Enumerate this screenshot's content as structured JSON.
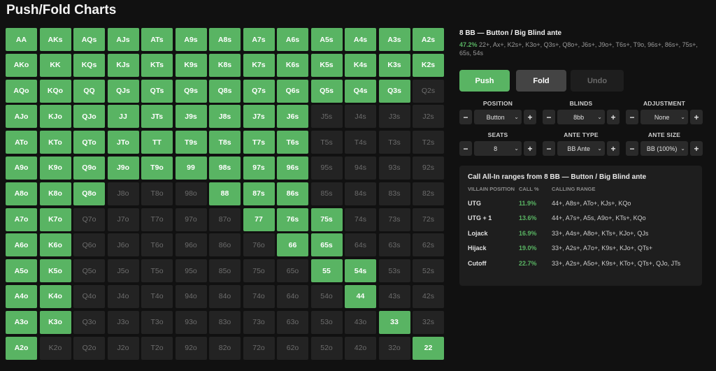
{
  "page": {
    "title": "Push/Fold Charts"
  },
  "colors": {
    "push": "#59b463",
    "fold": "#232323",
    "background": "#111111"
  },
  "grid": {
    "rows": [
      [
        {
          "hand": "AA",
          "action": "push"
        },
        {
          "hand": "AKs",
          "action": "push"
        },
        {
          "hand": "AQs",
          "action": "push"
        },
        {
          "hand": "AJs",
          "action": "push"
        },
        {
          "hand": "ATs",
          "action": "push"
        },
        {
          "hand": "A9s",
          "action": "push"
        },
        {
          "hand": "A8s",
          "action": "push"
        },
        {
          "hand": "A7s",
          "action": "push"
        },
        {
          "hand": "A6s",
          "action": "push"
        },
        {
          "hand": "A5s",
          "action": "push"
        },
        {
          "hand": "A4s",
          "action": "push"
        },
        {
          "hand": "A3s",
          "action": "push"
        },
        {
          "hand": "A2s",
          "action": "push"
        }
      ],
      [
        {
          "hand": "AKo",
          "action": "push"
        },
        {
          "hand": "KK",
          "action": "push"
        },
        {
          "hand": "KQs",
          "action": "push"
        },
        {
          "hand": "KJs",
          "action": "push"
        },
        {
          "hand": "KTs",
          "action": "push"
        },
        {
          "hand": "K9s",
          "action": "push"
        },
        {
          "hand": "K8s",
          "action": "push"
        },
        {
          "hand": "K7s",
          "action": "push"
        },
        {
          "hand": "K6s",
          "action": "push"
        },
        {
          "hand": "K5s",
          "action": "push"
        },
        {
          "hand": "K4s",
          "action": "push"
        },
        {
          "hand": "K3s",
          "action": "push"
        },
        {
          "hand": "K2s",
          "action": "push"
        }
      ],
      [
        {
          "hand": "AQo",
          "action": "push"
        },
        {
          "hand": "KQo",
          "action": "push"
        },
        {
          "hand": "QQ",
          "action": "push"
        },
        {
          "hand": "QJs",
          "action": "push"
        },
        {
          "hand": "QTs",
          "action": "push"
        },
        {
          "hand": "Q9s",
          "action": "push"
        },
        {
          "hand": "Q8s",
          "action": "push"
        },
        {
          "hand": "Q7s",
          "action": "push"
        },
        {
          "hand": "Q6s",
          "action": "push"
        },
        {
          "hand": "Q5s",
          "action": "push"
        },
        {
          "hand": "Q4s",
          "action": "push"
        },
        {
          "hand": "Q3s",
          "action": "push"
        },
        {
          "hand": "Q2s",
          "action": "fold"
        }
      ],
      [
        {
          "hand": "AJo",
          "action": "push"
        },
        {
          "hand": "KJo",
          "action": "push"
        },
        {
          "hand": "QJo",
          "action": "push"
        },
        {
          "hand": "JJ",
          "action": "push"
        },
        {
          "hand": "JTs",
          "action": "push"
        },
        {
          "hand": "J9s",
          "action": "push"
        },
        {
          "hand": "J8s",
          "action": "push"
        },
        {
          "hand": "J7s",
          "action": "push"
        },
        {
          "hand": "J6s",
          "action": "push"
        },
        {
          "hand": "J5s",
          "action": "fold"
        },
        {
          "hand": "J4s",
          "action": "fold"
        },
        {
          "hand": "J3s",
          "action": "fold"
        },
        {
          "hand": "J2s",
          "action": "fold"
        }
      ],
      [
        {
          "hand": "ATo",
          "action": "push"
        },
        {
          "hand": "KTo",
          "action": "push"
        },
        {
          "hand": "QTo",
          "action": "push"
        },
        {
          "hand": "JTo",
          "action": "push"
        },
        {
          "hand": "TT",
          "action": "push"
        },
        {
          "hand": "T9s",
          "action": "push"
        },
        {
          "hand": "T8s",
          "action": "push"
        },
        {
          "hand": "T7s",
          "action": "push"
        },
        {
          "hand": "T6s",
          "action": "push"
        },
        {
          "hand": "T5s",
          "action": "fold"
        },
        {
          "hand": "T4s",
          "action": "fold"
        },
        {
          "hand": "T3s",
          "action": "fold"
        },
        {
          "hand": "T2s",
          "action": "fold"
        }
      ],
      [
        {
          "hand": "A9o",
          "action": "push"
        },
        {
          "hand": "K9o",
          "action": "push"
        },
        {
          "hand": "Q9o",
          "action": "push"
        },
        {
          "hand": "J9o",
          "action": "push"
        },
        {
          "hand": "T9o",
          "action": "push"
        },
        {
          "hand": "99",
          "action": "push"
        },
        {
          "hand": "98s",
          "action": "push"
        },
        {
          "hand": "97s",
          "action": "push"
        },
        {
          "hand": "96s",
          "action": "push"
        },
        {
          "hand": "95s",
          "action": "fold"
        },
        {
          "hand": "94s",
          "action": "fold"
        },
        {
          "hand": "93s",
          "action": "fold"
        },
        {
          "hand": "92s",
          "action": "fold"
        }
      ],
      [
        {
          "hand": "A8o",
          "action": "push"
        },
        {
          "hand": "K8o",
          "action": "push"
        },
        {
          "hand": "Q8o",
          "action": "push"
        },
        {
          "hand": "J8o",
          "action": "fold"
        },
        {
          "hand": "T8o",
          "action": "fold"
        },
        {
          "hand": "98o",
          "action": "fold"
        },
        {
          "hand": "88",
          "action": "push"
        },
        {
          "hand": "87s",
          "action": "push"
        },
        {
          "hand": "86s",
          "action": "push"
        },
        {
          "hand": "85s",
          "action": "fold"
        },
        {
          "hand": "84s",
          "action": "fold"
        },
        {
          "hand": "83s",
          "action": "fold"
        },
        {
          "hand": "82s",
          "action": "fold"
        }
      ],
      [
        {
          "hand": "A7o",
          "action": "push"
        },
        {
          "hand": "K7o",
          "action": "push"
        },
        {
          "hand": "Q7o",
          "action": "fold"
        },
        {
          "hand": "J7o",
          "action": "fold"
        },
        {
          "hand": "T7o",
          "action": "fold"
        },
        {
          "hand": "97o",
          "action": "fold"
        },
        {
          "hand": "87o",
          "action": "fold"
        },
        {
          "hand": "77",
          "action": "push"
        },
        {
          "hand": "76s",
          "action": "push"
        },
        {
          "hand": "75s",
          "action": "push"
        },
        {
          "hand": "74s",
          "action": "fold"
        },
        {
          "hand": "73s",
          "action": "fold"
        },
        {
          "hand": "72s",
          "action": "fold"
        }
      ],
      [
        {
          "hand": "A6o",
          "action": "push"
        },
        {
          "hand": "K6o",
          "action": "push"
        },
        {
          "hand": "Q6o",
          "action": "fold"
        },
        {
          "hand": "J6o",
          "action": "fold"
        },
        {
          "hand": "T6o",
          "action": "fold"
        },
        {
          "hand": "96o",
          "action": "fold"
        },
        {
          "hand": "86o",
          "action": "fold"
        },
        {
          "hand": "76o",
          "action": "fold"
        },
        {
          "hand": "66",
          "action": "push"
        },
        {
          "hand": "65s",
          "action": "push"
        },
        {
          "hand": "64s",
          "action": "fold"
        },
        {
          "hand": "63s",
          "action": "fold"
        },
        {
          "hand": "62s",
          "action": "fold"
        }
      ],
      [
        {
          "hand": "A5o",
          "action": "push"
        },
        {
          "hand": "K5o",
          "action": "push"
        },
        {
          "hand": "Q5o",
          "action": "fold"
        },
        {
          "hand": "J5o",
          "action": "fold"
        },
        {
          "hand": "T5o",
          "action": "fold"
        },
        {
          "hand": "95o",
          "action": "fold"
        },
        {
          "hand": "85o",
          "action": "fold"
        },
        {
          "hand": "75o",
          "action": "fold"
        },
        {
          "hand": "65o",
          "action": "fold"
        },
        {
          "hand": "55",
          "action": "push"
        },
        {
          "hand": "54s",
          "action": "push"
        },
        {
          "hand": "53s",
          "action": "fold"
        },
        {
          "hand": "52s",
          "action": "fold"
        }
      ],
      [
        {
          "hand": "A4o",
          "action": "push"
        },
        {
          "hand": "K4o",
          "action": "push"
        },
        {
          "hand": "Q4o",
          "action": "fold"
        },
        {
          "hand": "J4o",
          "action": "fold"
        },
        {
          "hand": "T4o",
          "action": "fold"
        },
        {
          "hand": "94o",
          "action": "fold"
        },
        {
          "hand": "84o",
          "action": "fold"
        },
        {
          "hand": "74o",
          "action": "fold"
        },
        {
          "hand": "64o",
          "action": "fold"
        },
        {
          "hand": "54o",
          "action": "fold"
        },
        {
          "hand": "44",
          "action": "push"
        },
        {
          "hand": "43s",
          "action": "fold"
        },
        {
          "hand": "42s",
          "action": "fold"
        }
      ],
      [
        {
          "hand": "A3o",
          "action": "push"
        },
        {
          "hand": "K3o",
          "action": "push"
        },
        {
          "hand": "Q3o",
          "action": "fold"
        },
        {
          "hand": "J3o",
          "action": "fold"
        },
        {
          "hand": "T3o",
          "action": "fold"
        },
        {
          "hand": "93o",
          "action": "fold"
        },
        {
          "hand": "83o",
          "action": "fold"
        },
        {
          "hand": "73o",
          "action": "fold"
        },
        {
          "hand": "63o",
          "action": "fold"
        },
        {
          "hand": "53o",
          "action": "fold"
        },
        {
          "hand": "43o",
          "action": "fold"
        },
        {
          "hand": "33",
          "action": "push"
        },
        {
          "hand": "32s",
          "action": "fold"
        }
      ],
      [
        {
          "hand": "A2o",
          "action": "push"
        },
        {
          "hand": "K2o",
          "action": "fold"
        },
        {
          "hand": "Q2o",
          "action": "fold"
        },
        {
          "hand": "J2o",
          "action": "fold"
        },
        {
          "hand": "T2o",
          "action": "fold"
        },
        {
          "hand": "92o",
          "action": "fold"
        },
        {
          "hand": "82o",
          "action": "fold"
        },
        {
          "hand": "72o",
          "action": "fold"
        },
        {
          "hand": "62o",
          "action": "fold"
        },
        {
          "hand": "52o",
          "action": "fold"
        },
        {
          "hand": "42o",
          "action": "fold"
        },
        {
          "hand": "32o",
          "action": "fold"
        },
        {
          "hand": "22",
          "action": "push"
        }
      ]
    ]
  },
  "scenario": {
    "title": "8 BB — Button / Big Blind ante",
    "percent": "47.2%",
    "range": "22+, Ax+, K2s+, K3o+, Q3s+, Q8o+, J6s+, J9o+, T6s+, T9o, 96s+, 86s+, 75s+, 65s, 54s"
  },
  "actions": {
    "push": "Push",
    "fold": "Fold",
    "undo": "Undo"
  },
  "selectors": {
    "position": {
      "label": "POSITION",
      "value": "Button"
    },
    "blinds": {
      "label": "BLINDS",
      "value": "8bb"
    },
    "adjustment": {
      "label": "ADJUSTMENT",
      "value": "None"
    },
    "seats": {
      "label": "SEATS",
      "value": "8"
    },
    "ante_type": {
      "label": "ANTE TYPE",
      "value": "BB Ante"
    },
    "ante_size": {
      "label": "ANTE SIZE",
      "value": "BB (100%)"
    },
    "minus": "−",
    "plus": "+",
    "chevron": "⌄"
  },
  "call_ranges": {
    "title": "Call All-In ranges from 8 BB — Button / Big Blind ante",
    "headers": {
      "villain": "VILLAIN POSITION",
      "call_pct": "CALL %",
      "range": "CALLING RANGE"
    },
    "rows": [
      {
        "position": "UTG",
        "pct": "11.9%",
        "range": "44+, A8s+, ATo+, KJs+, KQo"
      },
      {
        "position": "UTG + 1",
        "pct": "13.6%",
        "range": "44+, A7s+, A5s, A9o+, KTs+, KQo"
      },
      {
        "position": "Lojack",
        "pct": "16.9%",
        "range": "33+, A4s+, A8o+, KTs+, KJo+, QJs"
      },
      {
        "position": "Hijack",
        "pct": "19.0%",
        "range": "33+, A2s+, A7o+, K9s+, KJo+, QTs+"
      },
      {
        "position": "Cutoff",
        "pct": "22.7%",
        "range": "33+, A2s+, A5o+, K9s+, KTo+, QTs+, QJo, JTs"
      }
    ]
  }
}
